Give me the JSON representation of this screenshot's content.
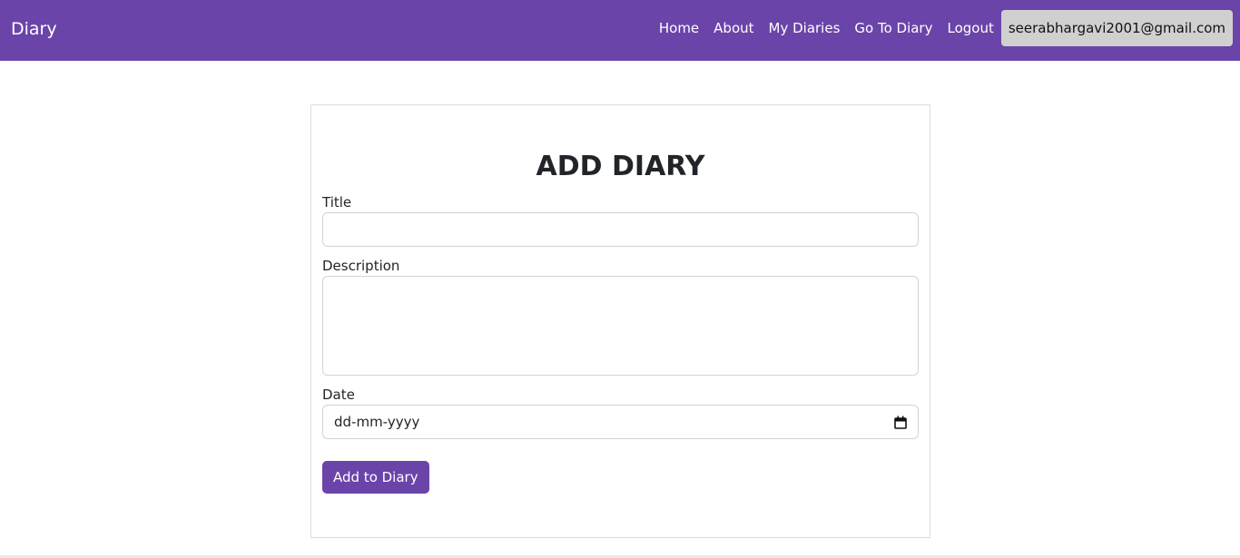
{
  "navbar": {
    "brand": "Diary",
    "links": [
      "Home",
      "About",
      "My Diaries",
      "Go To Diary",
      "Logout"
    ],
    "user_email": "seerabhargavi2001@gmail.com"
  },
  "form": {
    "heading": "ADD DIARY",
    "title_label": "Title",
    "title_value": "",
    "description_label": "Description",
    "description_value": "",
    "date_label": "Date",
    "date_placeholder": "dd-mm-yyyy",
    "submit_label": "Add to Diary",
    "calendar_icon": "calendar-icon"
  },
  "colors": {
    "primary": "#6a44a9",
    "user_badge_bg": "#d0d0d0"
  }
}
